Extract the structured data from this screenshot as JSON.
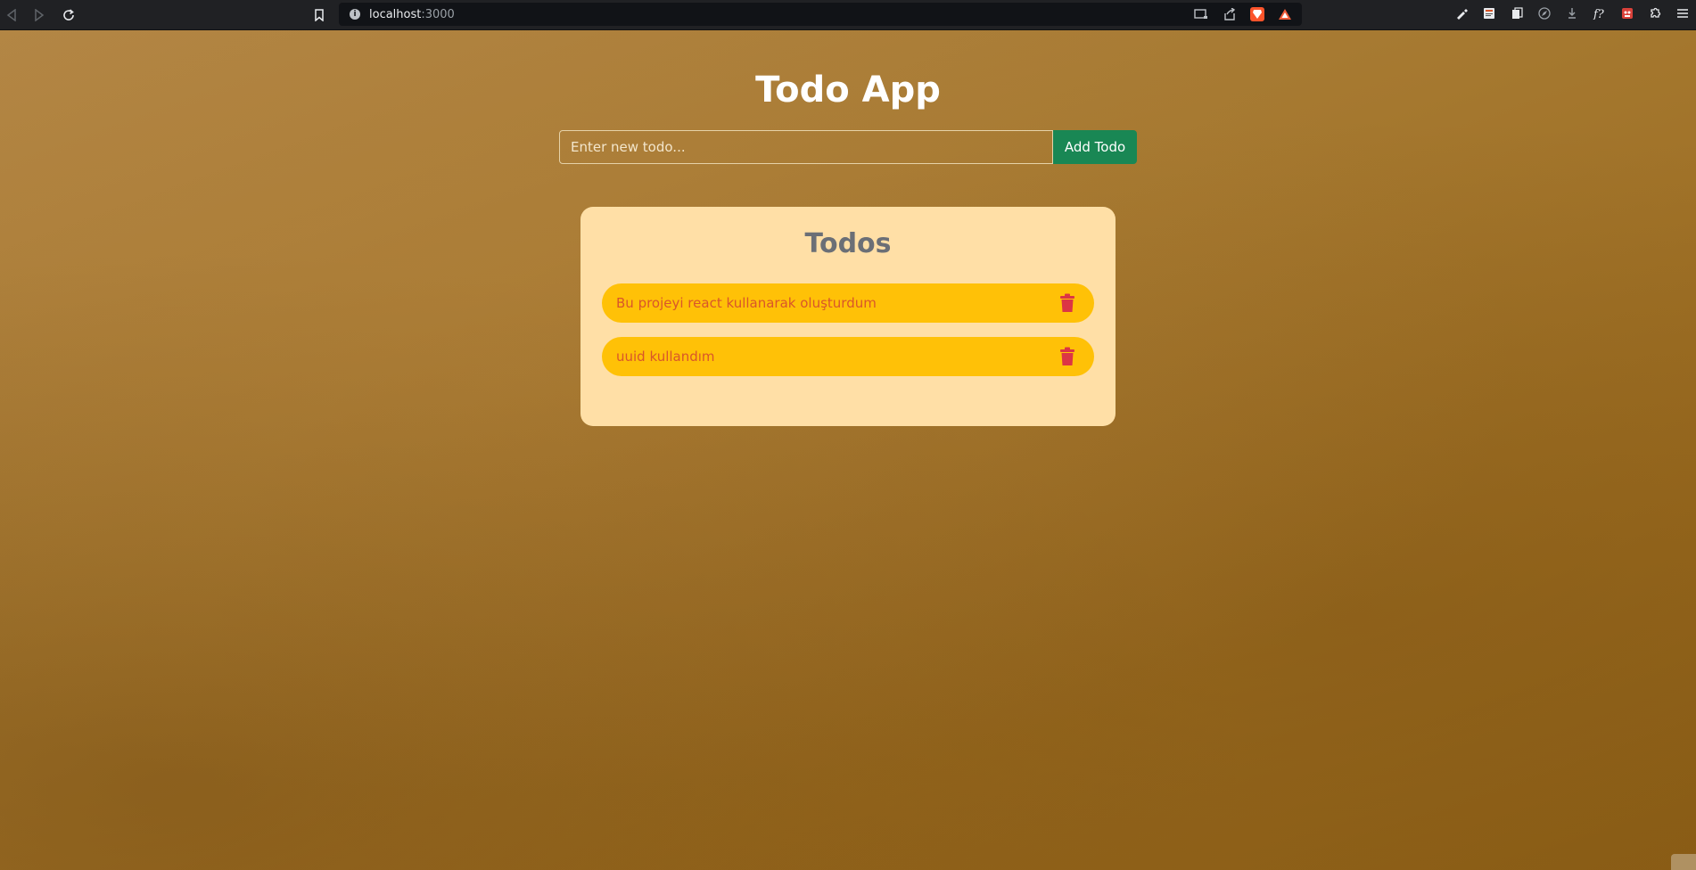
{
  "browser": {
    "url_host": "localhost",
    "url_port": ":3000",
    "url_info": "i"
  },
  "app": {
    "title": "Todo App"
  },
  "form": {
    "input_placeholder": "Enter new todo...",
    "input_value": "",
    "add_label": "Add Todo"
  },
  "todos": {
    "heading": "Todos",
    "items": [
      {
        "text": "Bu projeyi react kullanarak oluşturdum"
      },
      {
        "text": "uuid kullandım"
      }
    ]
  },
  "colors": {
    "add_button": "#198754",
    "card_bg": "#ffdfa6",
    "item_bg": "#ffc107",
    "item_text": "#d9562a",
    "trash": "#dc3545"
  },
  "icons": [
    "back-icon",
    "forward-icon",
    "reload-icon",
    "bookmark-icon",
    "info-icon",
    "cast-icon",
    "share-icon",
    "brave-shield-icon",
    "brave-rewards-icon",
    "pen-icon",
    "reader-icon",
    "copy-icon",
    "compass-icon",
    "download-icon",
    "function-icon",
    "extension-icon",
    "puzzle-icon",
    "menu-icon",
    "trash-icon"
  ]
}
